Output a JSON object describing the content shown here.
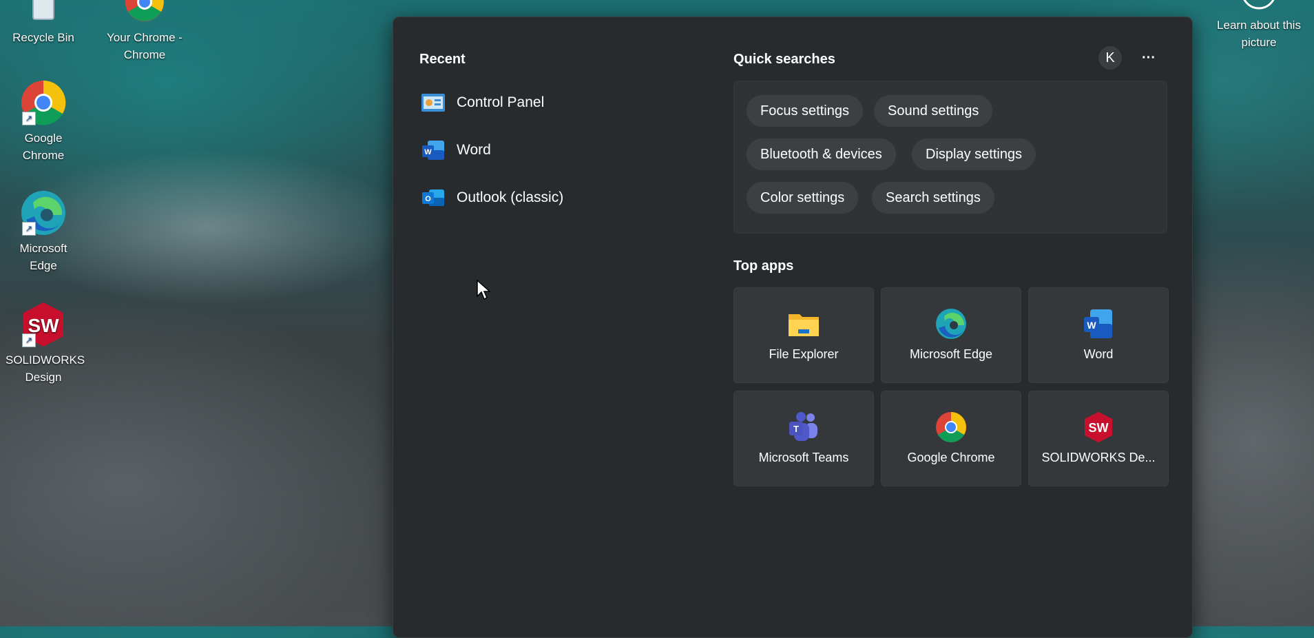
{
  "desktop": {
    "icons": [
      {
        "label": "Recycle Bin"
      },
      {
        "label": "Your Chrome - Chrome"
      },
      {
        "label": "Google Chrome"
      },
      {
        "label": "Microsoft Edge"
      },
      {
        "label": "SOLIDWORKS Design"
      }
    ],
    "spotlight_label": "Learn about this picture"
  },
  "start": {
    "recent_heading": "Recent",
    "recent": [
      {
        "label": "Control Panel",
        "icon": "control-panel-icon"
      },
      {
        "label": "Word",
        "icon": "word-icon"
      },
      {
        "label": "Outlook (classic)",
        "icon": "outlook-icon"
      }
    ],
    "quick_heading": "Quick searches",
    "avatar_letter": "K",
    "more_label": "···",
    "quick": [
      "Focus settings",
      "Sound settings",
      "Bluetooth & devices",
      "Display settings",
      "Color settings",
      "Search settings"
    ],
    "top_heading": "Top apps",
    "top_apps": [
      {
        "label": "File Explorer",
        "icon": "folder-icon"
      },
      {
        "label": "Microsoft Edge",
        "icon": "edge-icon"
      },
      {
        "label": "Word",
        "icon": "word-icon"
      },
      {
        "label": "Microsoft Teams",
        "icon": "teams-icon"
      },
      {
        "label": "Google Chrome",
        "icon": "chrome-icon"
      },
      {
        "label": "SOLIDWORKS De...",
        "icon": "solidworks-icon"
      }
    ]
  },
  "colors": {
    "panel": "#272b2e",
    "chip": "#3c4043",
    "tile": "#34383b",
    "word_blue": "#185abd",
    "edge_teal": "#1fa3b7",
    "sw_red": "#c8102e"
  }
}
